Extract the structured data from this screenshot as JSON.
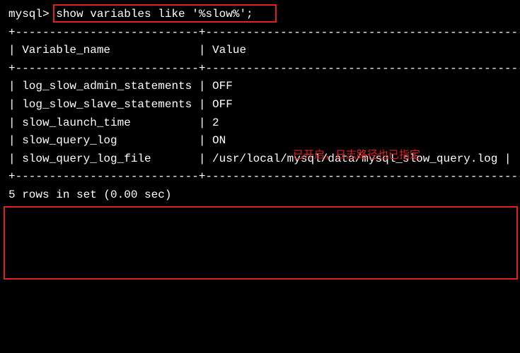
{
  "prompt": "mysql>",
  "command": " show variables like '%slow%';",
  "separator1": "+---------------------------+------------------------------------------------+",
  "header": {
    "col1": "Variable_name",
    "col2": "Value"
  },
  "header_line": "| Variable_name             | Value                                          |",
  "rows": [
    {
      "name": "log_slow_admin_statements",
      "value": "OFF",
      "line": "| log_slow_admin_statements | OFF                                            |"
    },
    {
      "name": "log_slow_slave_statements",
      "value": "OFF",
      "line": "| log_slow_slave_statements | OFF                                            |"
    },
    {
      "name": "slow_launch_time",
      "value": "2",
      "line": "| slow_launch_time          | 2                                              |"
    },
    {
      "name": "slow_query_log",
      "value": "ON",
      "line": "| slow_query_log            | ON                                             |"
    },
    {
      "name": "slow_query_log_file",
      "value": "/usr/local/mysql/data/mysql_slow_query.log",
      "line": "| slow_query_log_file       | /usr/local/mysql/data/mysql_slow_query.log |"
    }
  ],
  "footer": "5 rows in set (0.00 sec)",
  "annotation": "已开启，日志路径也已指定",
  "colors": {
    "background": "#000000",
    "text": "#ffffff",
    "highlight": "#e02020"
  }
}
